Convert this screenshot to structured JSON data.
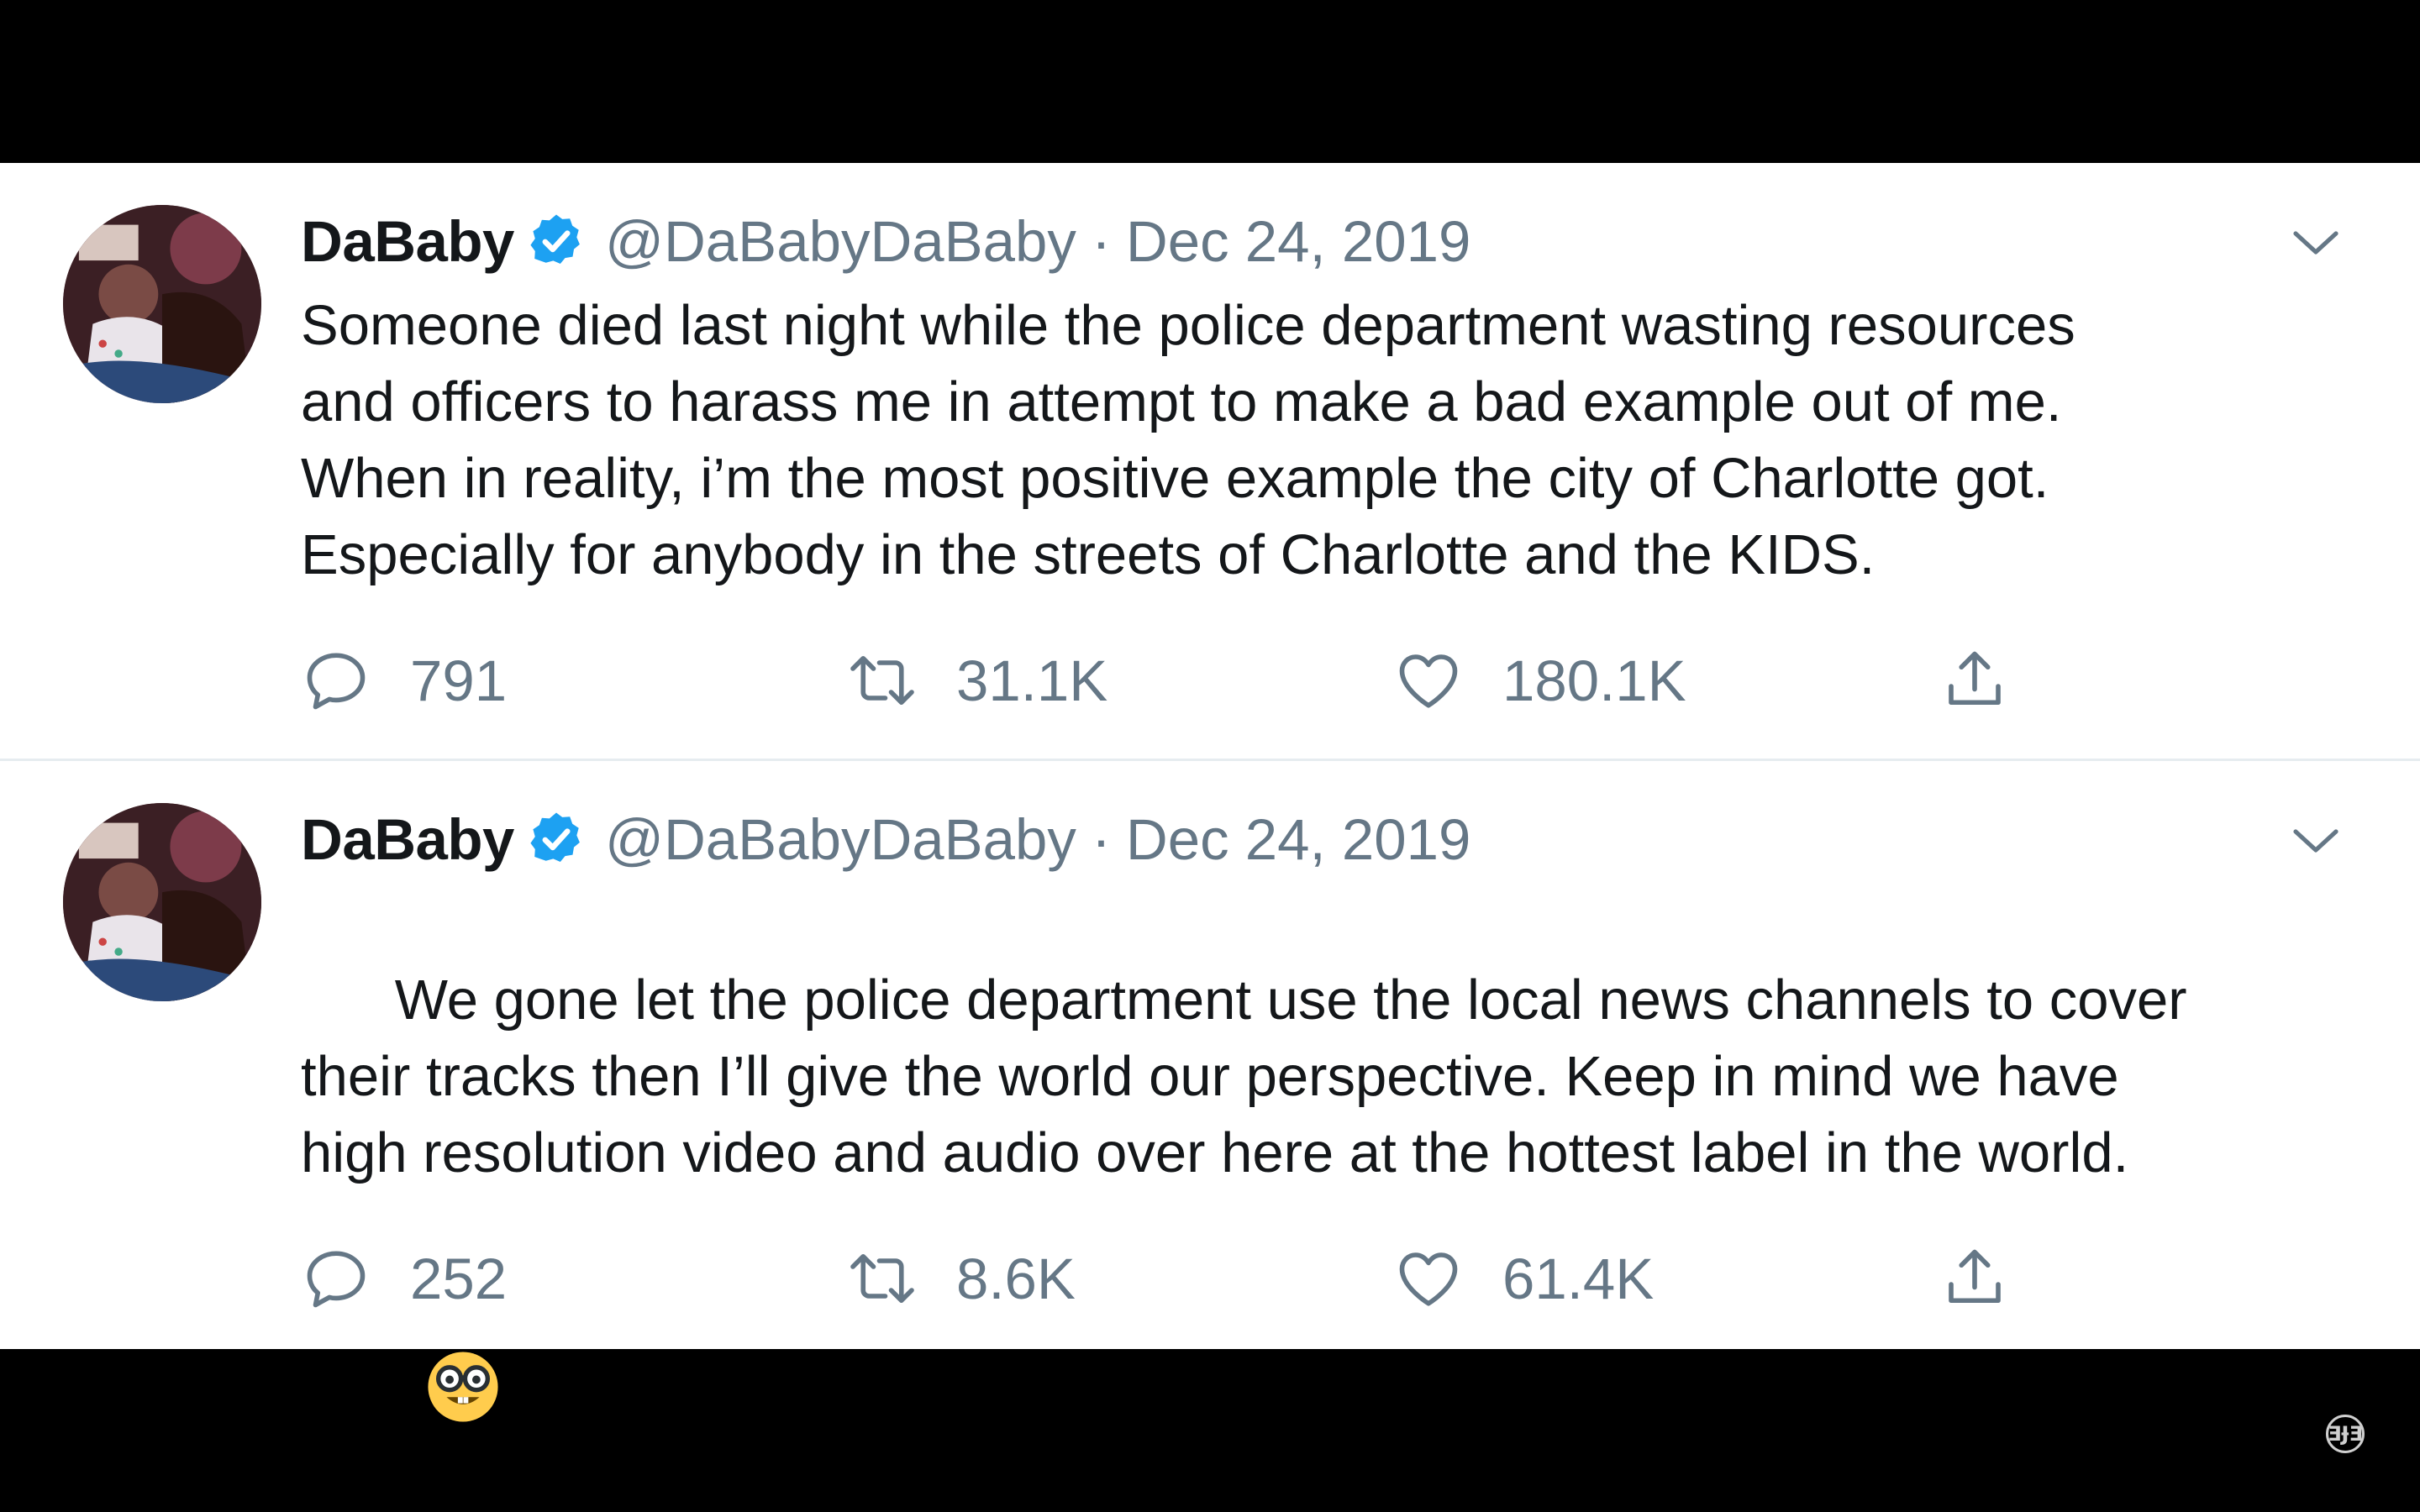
{
  "tweets": [
    {
      "name": "DaBaby",
      "handle": "@DaBabyDaBaby",
      "separator": "·",
      "date": "Dec 24, 2019",
      "text": "Someone died last night while the police department wasting resources\nand officers to harass me in attempt to make a bad example out of me.\nWhen in reality, i’m the most positive example the city of Charlotte got.\nEspecially for anybody in the streets of Charlotte and the KIDS.",
      "emoji": null,
      "replies": "791",
      "retweets": "31.1K",
      "likes": "180.1K"
    },
    {
      "name": "DaBaby",
      "handle": "@DaBabyDaBaby",
      "separator": "·",
      "date": "Dec 24, 2019",
      "text": "We gone let the police department use the local news channels to cover\ntheir tracks then I’ll give the world our perspective. Keep in mind we have\nhigh resolution video and audio over here at the hottest label in the world.",
      "emoji": "nerd-face",
      "replies": "252",
      "retweets": "8.6K",
      "likes": "61.4K"
    }
  ],
  "icons": {
    "reply": "reply-icon",
    "retweet": "retweet-icon",
    "like": "heart-icon",
    "share": "share-icon",
    "menu": "chevron-down-icon",
    "verified": "verified-badge-icon"
  },
  "colors": {
    "verified": "#1da1f2",
    "text": "#14171a",
    "muted": "#657786",
    "divider": "#e6ecf0"
  },
  "watermark": "ƎɈƎ"
}
